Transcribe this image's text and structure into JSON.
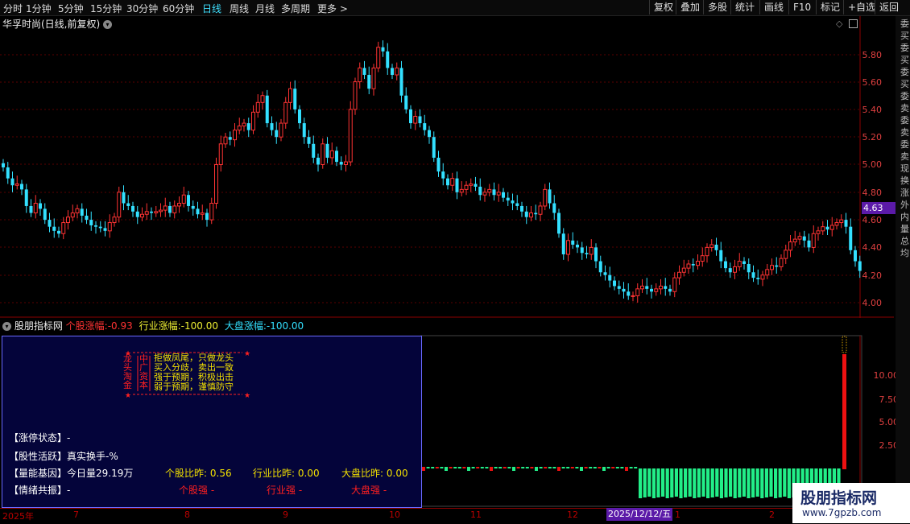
{
  "toolbar": {
    "periods": [
      "分时",
      "1分钟",
      "5分钟",
      "15分钟",
      "30分钟",
      "60分钟",
      "日线",
      "周线",
      "月线",
      "多周期",
      "更多 >"
    ],
    "active_period": "日线",
    "buttons": [
      "复权",
      "叠加",
      "多股",
      "统计",
      "画线",
      "F10",
      "标记",
      "+自选",
      "返回"
    ]
  },
  "stock": {
    "title": "华孚时尚(日线,前复权)"
  },
  "price_axis": [
    "5.80",
    "5.60",
    "5.40",
    "5.20",
    "5.00",
    "4.80",
    "4.60",
    "4.40",
    "4.20",
    "4.00"
  ],
  "current_price": "4.63",
  "right_strip": "委买委买委买委卖委卖委卖现换涨外内量总均",
  "indicator": {
    "name": "股朋指标网",
    "stock_change_label": "个股涨幅:",
    "stock_change_value": "-0.93",
    "industry_change_label": "行业涨幅:",
    "industry_change_value": "-100.00",
    "market_change_label": "大盘涨幅:",
    "market_change_value": "-100.00",
    "axis": [
      "10.00",
      "7.50",
      "5.00",
      "2.50"
    ]
  },
  "banner": {
    "left_col1": "龙头淘金",
    "left_col2": "中广资本",
    "lines": [
      "拒做凤尾，只做龙头",
      "买入分歧，卖出一致",
      "强于预期，积极出击",
      "弱于预期，谨慎防守"
    ]
  },
  "panel": {
    "limit_status_label": "【涨停状态】",
    "limit_status_value": "-",
    "activity_label": "【股性活跃】",
    "activity_value": "真实换手-%",
    "volume_label": "【量能基因】",
    "volume_value": "今日量29.19万",
    "stock_ratio_label": "个股比昨:",
    "stock_ratio_value": "0.56",
    "industry_ratio_label": "行业比昨:",
    "industry_ratio_value": "0.00",
    "market_ratio_label": "大盘比昨:",
    "market_ratio_value": "0.00",
    "sentiment_label": "【情绪共振】",
    "sentiment_value": "-",
    "stock_strong": "个股强 -",
    "industry_strong": "行业强 -",
    "market_strong": "大盘强 -"
  },
  "time_axis": [
    "2025年",
    "7",
    "8",
    "9",
    "10",
    "11",
    "12",
    "1",
    "2"
  ],
  "cursor_date": "2025/12/12/五",
  "watermark": {
    "line1": "股朋指标网",
    "line2": "www.7gpzb.com"
  },
  "colors": {
    "up": "#ff3333",
    "down": "#33e0ff",
    "active": "#3fe0ff",
    "panel_bg": "#04043a",
    "bar_green": "#22ee88",
    "bar_red": "#ee1111"
  },
  "chart_data": {
    "type": "candlestick",
    "close": [
      4.98,
      4.9,
      4.85,
      4.86,
      4.82,
      4.7,
      4.65,
      4.72,
      4.68,
      4.6,
      4.55,
      4.52,
      4.5,
      4.58,
      4.62,
      4.65,
      4.68,
      4.63,
      4.6,
      4.56,
      4.55,
      4.54,
      4.52,
      4.58,
      4.62,
      4.8,
      4.72,
      4.7,
      4.66,
      4.62,
      4.64,
      4.66,
      4.65,
      4.66,
      4.67,
      4.7,
      4.65,
      4.7,
      4.72,
      4.78,
      4.7,
      4.68,
      4.64,
      4.65,
      4.6,
      4.72,
      5.0,
      5.15,
      5.2,
      5.18,
      5.25,
      5.28,
      5.3,
      5.25,
      5.38,
      5.45,
      5.5,
      5.3,
      5.25,
      5.2,
      5.3,
      5.45,
      5.55,
      5.4,
      5.3,
      5.2,
      5.15,
      5.05,
      5.0,
      5.15,
      5.05,
      5.1,
      5.02,
      5.0,
      5.02,
      5.4,
      5.6,
      5.7,
      5.65,
      5.55,
      5.7,
      5.85,
      5.82,
      5.7,
      5.65,
      5.7,
      5.5,
      5.4,
      5.3,
      5.35,
      5.3,
      5.25,
      5.2,
      5.05,
      4.95,
      4.9,
      4.85,
      4.9,
      4.8,
      4.82,
      4.85,
      4.86,
      4.84,
      4.78,
      4.8,
      4.82,
      4.78,
      4.8,
      4.76,
      4.74,
      4.72,
      4.7,
      4.66,
      4.62,
      4.65,
      4.64,
      4.7,
      4.82,
      4.72,
      4.65,
      4.5,
      4.35,
      4.45,
      4.42,
      4.4,
      4.36,
      4.35,
      4.4,
      4.3,
      4.22,
      4.2,
      4.16,
      4.12,
      4.1,
      4.08,
      4.05,
      4.05,
      4.1,
      4.12,
      4.1,
      4.08,
      4.1,
      4.12,
      4.1,
      4.08,
      4.18,
      4.22,
      4.25,
      4.28,
      4.27,
      4.3,
      4.34,
      4.4,
      4.42,
      4.38,
      4.3,
      4.25,
      4.22,
      4.26,
      4.3,
      4.28,
      4.22,
      4.18,
      4.17,
      4.2,
      4.24,
      4.27,
      4.26,
      4.32,
      4.38,
      4.44,
      4.46,
      4.48,
      4.45,
      4.4,
      4.5,
      4.52,
      4.55,
      4.53,
      4.56,
      4.58,
      4.6,
      4.55,
      4.38,
      4.3,
      4.23
    ]
  }
}
